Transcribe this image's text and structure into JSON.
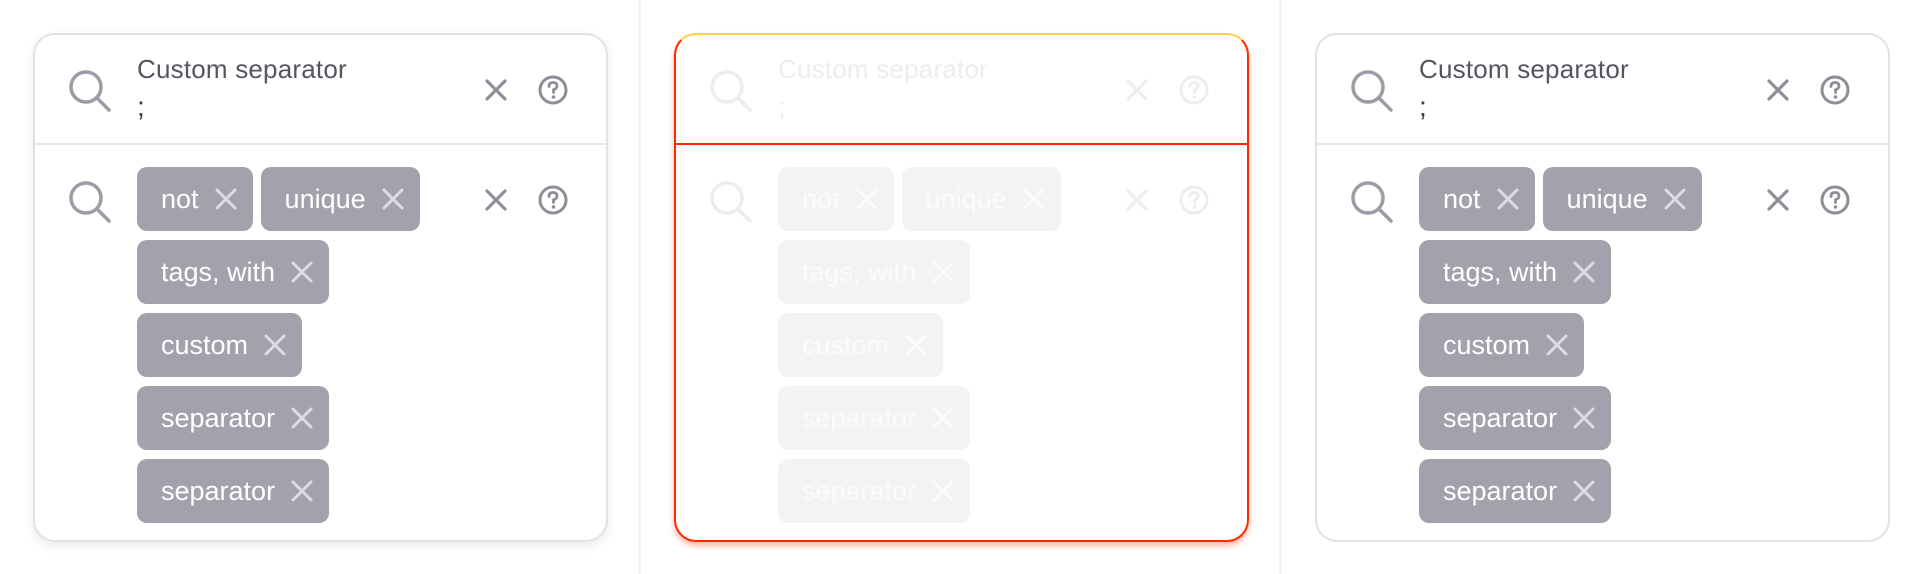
{
  "colors": {
    "tag_background": "#a2a2ac",
    "icon_stroke": "#9c9ca6",
    "disabled_border": "#ff2a00"
  },
  "icons": {
    "search": "search-icon",
    "clear": "close-icon",
    "help": "help-circle-icon",
    "tag_remove": "x-icon"
  },
  "fields": [
    {
      "state": "default",
      "input": {
        "label": "Custom separator",
        "value": ";"
      },
      "tags": [
        "not",
        "unique",
        "tags, with",
        "custom",
        "separator",
        "separator"
      ]
    },
    {
      "state": "disabled",
      "input": {
        "label": "Custom separator",
        "value": ";"
      },
      "tags": [
        "not",
        "unique",
        "tags, with",
        "custom",
        "separator",
        "separator"
      ]
    },
    {
      "state": "default",
      "input": {
        "label": "Custom separator",
        "value": ";"
      },
      "tags": [
        "not",
        "unique",
        "tags, with",
        "custom",
        "separator",
        "separator"
      ]
    }
  ]
}
